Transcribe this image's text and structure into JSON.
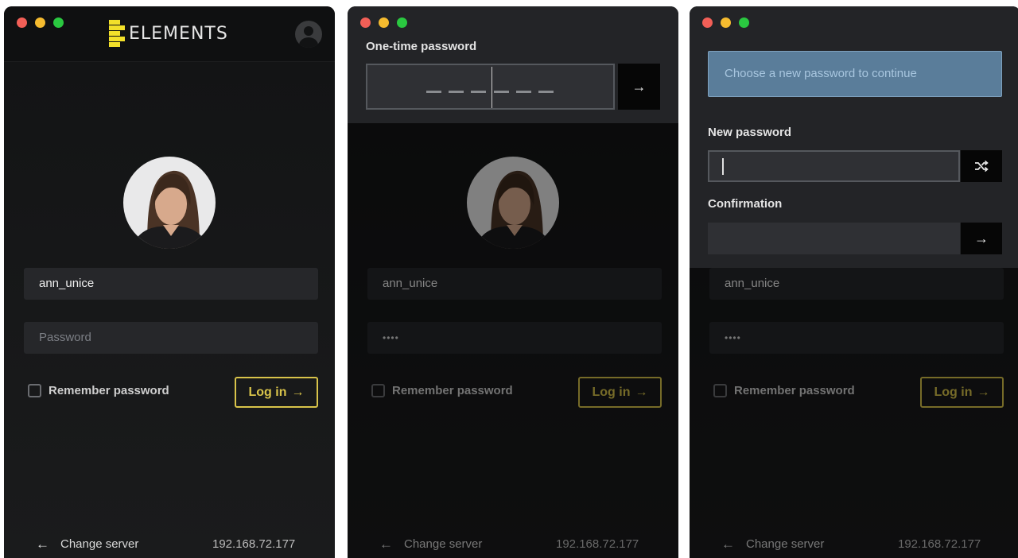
{
  "login": {
    "app_name": "ELEMENTS",
    "username": "ann_unice",
    "password_placeholder": "Password",
    "password_masked": "••••",
    "remember_label": "Remember password",
    "login_label": "Log in",
    "change_server_label": "Change server",
    "server_ip": "192.168.72.177"
  },
  "otp": {
    "label": "One-time password"
  },
  "new_password": {
    "notice": "Choose a new password to continue",
    "new_label": "New password",
    "confirm_label": "Confirmation"
  },
  "colors": {
    "accent": "#d8c34a",
    "logo": "#f2e02a",
    "notice_bg": "#5a7d9a",
    "background": "#161718"
  },
  "icons": {
    "arrow_right": "→",
    "arrow_left": "←",
    "shuffle": "shuffle-icon",
    "account": "account-icon"
  }
}
